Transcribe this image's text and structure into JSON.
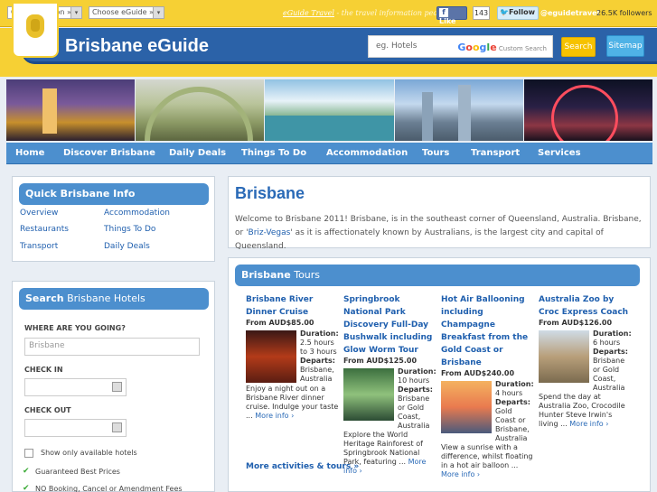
{
  "topbar": {
    "region_select": "Choose Region »",
    "eguide_select": "Choose eGuide »",
    "tagline_brand": "eGuide Travel",
    "tagline_rest": " - the travel information people.",
    "like_label": "Like",
    "like_count": "143",
    "follow_label": "Follow",
    "twitter_handle": "@eguidetravel",
    "followers": "26.5K followers"
  },
  "header": {
    "site_title": "Brisbane eGuide",
    "search_placeholder": "eg. Hotels",
    "custom_search": "Custom Search",
    "search_button": "Search",
    "sitemap_button": "Sitemap"
  },
  "nav": [
    "Home",
    "Discover Brisbane",
    "Daily Deals",
    "Things To Do",
    "Accommodation",
    "Tours",
    "Transport",
    "Services"
  ],
  "quick_info": {
    "title": "Quick Brisbane Info",
    "links": [
      "Overview",
      "Accommodation",
      "Restaurants",
      "Things To Do",
      "Transport",
      "Daily Deals"
    ]
  },
  "hotel_search": {
    "title_bold": "Search",
    "title_rest": " Brisbane Hotels",
    "where_label": "WHERE ARE YOU GOING?",
    "where_value": "Brisbane",
    "checkin_label": "CHECK IN",
    "checkout_label": "CHECK OUT",
    "available_only": "Show only available hotels",
    "benefits": [
      "Guaranteed Best Prices",
      "NO Booking, Cancel or Amendment Fees"
    ]
  },
  "welcome": {
    "heading": "Brisbane",
    "intro_part1": "Welcome to Brisbane 2011! Brisbane, is in the southeast corner of Queensland, Australia. Brisbane, or '",
    "intro_link": "Briz-Vegas",
    "intro_part2": "' as it is affectionately known by Australians, is the largest city and capital of Queensland."
  },
  "tours": {
    "title_bold": "Brisbane",
    "title_rest": " Tours",
    "items": [
      {
        "title": "Brisbane River Dinner Cruise",
        "price": "From AUD$85.00",
        "duration": "2.5 hours to 3 hours",
        "departs": "Brisbane, Australia",
        "desc": "Enjoy a night out on a Brisbane River dinner cruise. Indulge your taste ...",
        "more": "More info ›"
      },
      {
        "title": "Springbrook National Park Discovery Full-Day Bushwalk including Glow Worm Tour",
        "price": "From AUD$125.00",
        "duration": "10 hours",
        "departs": "Brisbane or Gold Coast, Australia",
        "desc": "Explore the World Heritage Rainforest of Springbrook National Park, featuring ...",
        "more": "More info ›"
      },
      {
        "title": "Hot Air Ballooning including Champagne Breakfast from the Gold Coast or Brisbane",
        "price": "From AUD$240.00",
        "duration": "4 hours",
        "departs": "Gold Coast or Brisbane, Australia",
        "desc": "View a sunrise with a difference, whilst floating in a hot air balloon ...",
        "more": "More info ›"
      },
      {
        "title": "Australia Zoo by Croc Express Coach",
        "price": "From AUD$126.00",
        "duration": "6 hours",
        "departs": "Brisbane or Gold Coast, Australia",
        "desc": "Spend the day at Australia Zoo, Crocodile Hunter Steve Irwin's living ...",
        "more": "More info ›"
      }
    ],
    "duration_label": "Duration:",
    "departs_label": "Departs:",
    "more_activities": "More activities & tours »"
  }
}
